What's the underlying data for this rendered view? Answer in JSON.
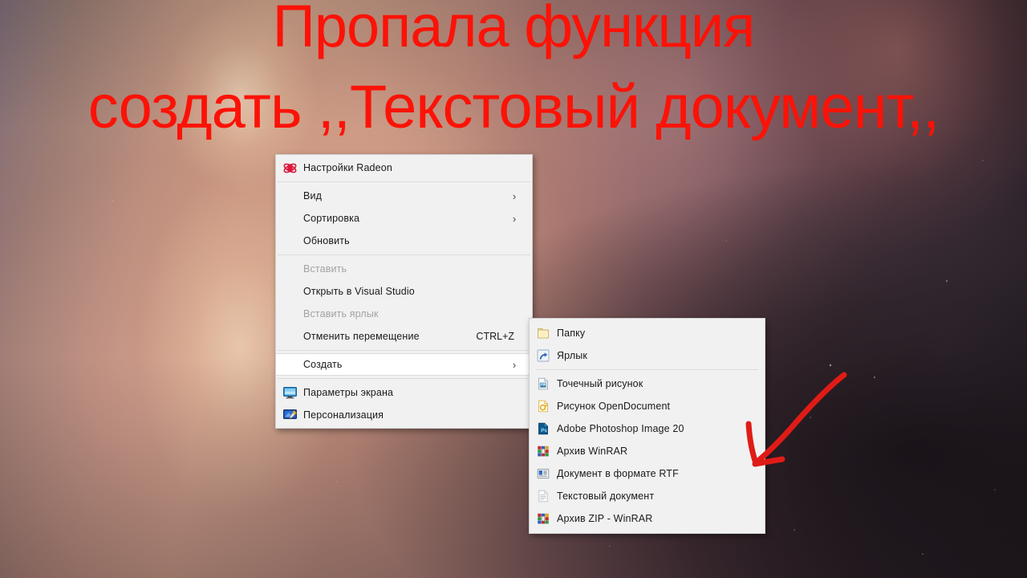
{
  "caption": {
    "line1": "Пропала функция",
    "line2": "создать ,,Текстовый документ,,",
    "color": "#fc1207"
  },
  "desktop": {
    "wallpaper_name": "galaxy-nebula-wallpaper",
    "dominant_colors": [
      "#d9ae93",
      "#b98d80",
      "#6e4c55",
      "#241c22"
    ]
  },
  "context_menu": {
    "name": "desktop-context-menu",
    "background_color": "#f1f1f1",
    "border_color": "#cfcfcf",
    "items": [
      {
        "label": "Настройки Radeon",
        "icon": "radeon-icon",
        "type": "item",
        "disabled": false,
        "submenu": false,
        "accel": ""
      },
      {
        "type": "separator"
      },
      {
        "label": "Вид",
        "icon": "",
        "type": "item",
        "disabled": false,
        "submenu": true,
        "accel": ""
      },
      {
        "label": "Сортировка",
        "icon": "",
        "type": "item",
        "disabled": false,
        "submenu": true,
        "accel": ""
      },
      {
        "label": "Обновить",
        "icon": "",
        "type": "item",
        "disabled": false,
        "submenu": false,
        "accel": ""
      },
      {
        "type": "separator"
      },
      {
        "label": "Вставить",
        "icon": "",
        "type": "item",
        "disabled": true,
        "submenu": false,
        "accel": ""
      },
      {
        "label": "Открыть в Visual Studio",
        "icon": "",
        "type": "item",
        "disabled": false,
        "submenu": false,
        "accel": ""
      },
      {
        "label": "Вставить ярлык",
        "icon": "",
        "type": "item",
        "disabled": true,
        "submenu": false,
        "accel": ""
      },
      {
        "label": "Отменить перемещение",
        "icon": "",
        "type": "item",
        "disabled": false,
        "submenu": false,
        "accel": "CTRL+Z"
      },
      {
        "type": "separator"
      },
      {
        "label": "Создать",
        "icon": "",
        "type": "item",
        "disabled": false,
        "submenu": true,
        "accel": "",
        "selected": true
      },
      {
        "type": "separator"
      },
      {
        "label": "Параметры экрана",
        "icon": "display-settings-icon",
        "type": "item",
        "disabled": false,
        "submenu": false,
        "accel": ""
      },
      {
        "label": "Персонализация",
        "icon": "personalization-icon",
        "type": "item",
        "disabled": false,
        "submenu": false,
        "accel": ""
      }
    ]
  },
  "new_submenu": {
    "name": "create-new-submenu",
    "items": [
      {
        "label": "Папку",
        "icon": "folder-icon",
        "type": "item"
      },
      {
        "label": "Ярлык",
        "icon": "shortcut-icon",
        "type": "item"
      },
      {
        "type": "separator"
      },
      {
        "label": "Точечный рисунок",
        "icon": "bitmap-image-icon",
        "type": "item"
      },
      {
        "label": "Рисунок OpenDocument",
        "icon": "opendocument-drawing-icon",
        "type": "item"
      },
      {
        "label": "Adobe Photoshop Image 20",
        "icon": "photoshop-icon",
        "type": "item"
      },
      {
        "label": "Архив WinRAR",
        "icon": "winrar-icon",
        "type": "item"
      },
      {
        "label": "Документ в формате RTF",
        "icon": "rtf-document-icon",
        "type": "item"
      },
      {
        "label": "Текстовый документ",
        "icon": "text-document-icon",
        "type": "item"
      },
      {
        "label": "Архив ZIP - WinRAR",
        "icon": "winrar-zip-icon",
        "type": "item"
      }
    ]
  },
  "annotation": {
    "name": "red-arrow-annotation",
    "color": "#e01b16",
    "points_to": "Текстовый документ"
  }
}
